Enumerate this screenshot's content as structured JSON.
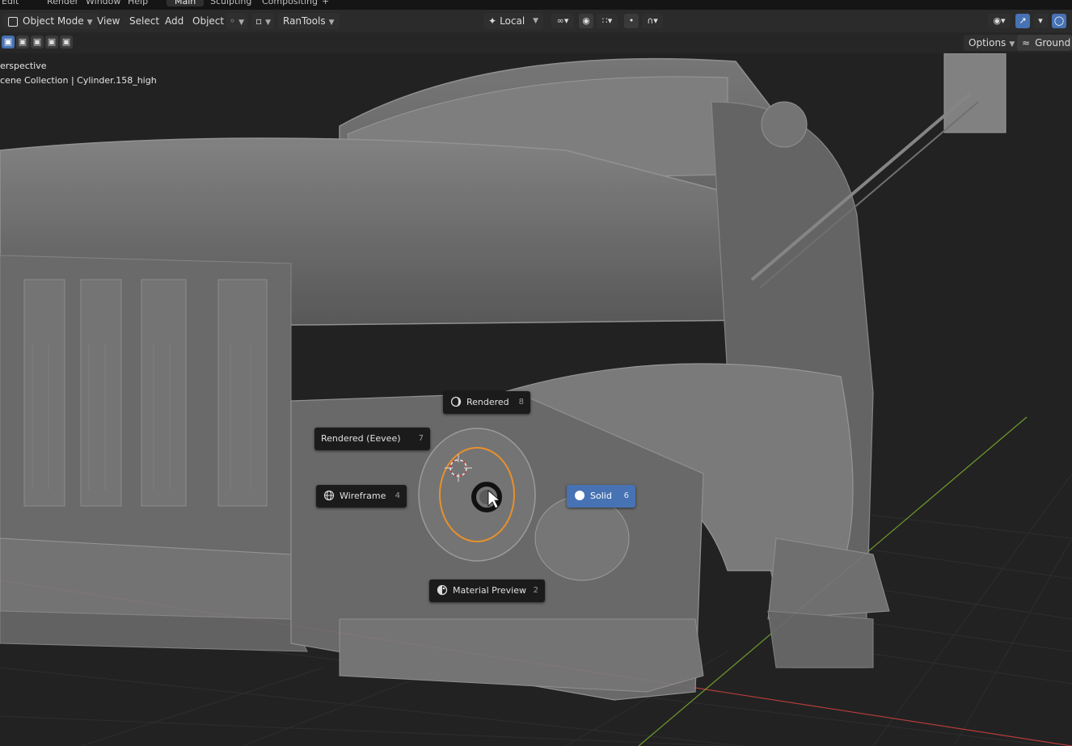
{
  "topmenu": {
    "items": [
      "Edit",
      "Render",
      "Window",
      "Help"
    ],
    "tabs": [
      "Main",
      "Sculpting",
      "Compositing"
    ],
    "add_tab": "+"
  },
  "header": {
    "mode": "Object Mode",
    "menus": [
      "View",
      "Select",
      "Add",
      "Object"
    ],
    "addon": "RanTools",
    "orientation": "Local"
  },
  "subheader": {
    "options_label": "Options",
    "ground_label": "Ground"
  },
  "viewport": {
    "view_name": "erspective",
    "collection_path": "cene Collection | Cylinder.158_high"
  },
  "pie_menu": {
    "items": [
      {
        "label": "Rendered",
        "key": "8"
      },
      {
        "label": "Rendered (Eevee)",
        "key": "7"
      },
      {
        "label": "Wireframe",
        "key": "4"
      },
      {
        "label": "Solid",
        "key": "6"
      },
      {
        "label": "Material Preview",
        "key": "2"
      }
    ]
  },
  "colors": {
    "accent": "#4772b3",
    "selection_outline": "#e8902a",
    "background": "#222222",
    "x_axis": "#b63c3c",
    "y_axis": "#6f9a2b"
  }
}
